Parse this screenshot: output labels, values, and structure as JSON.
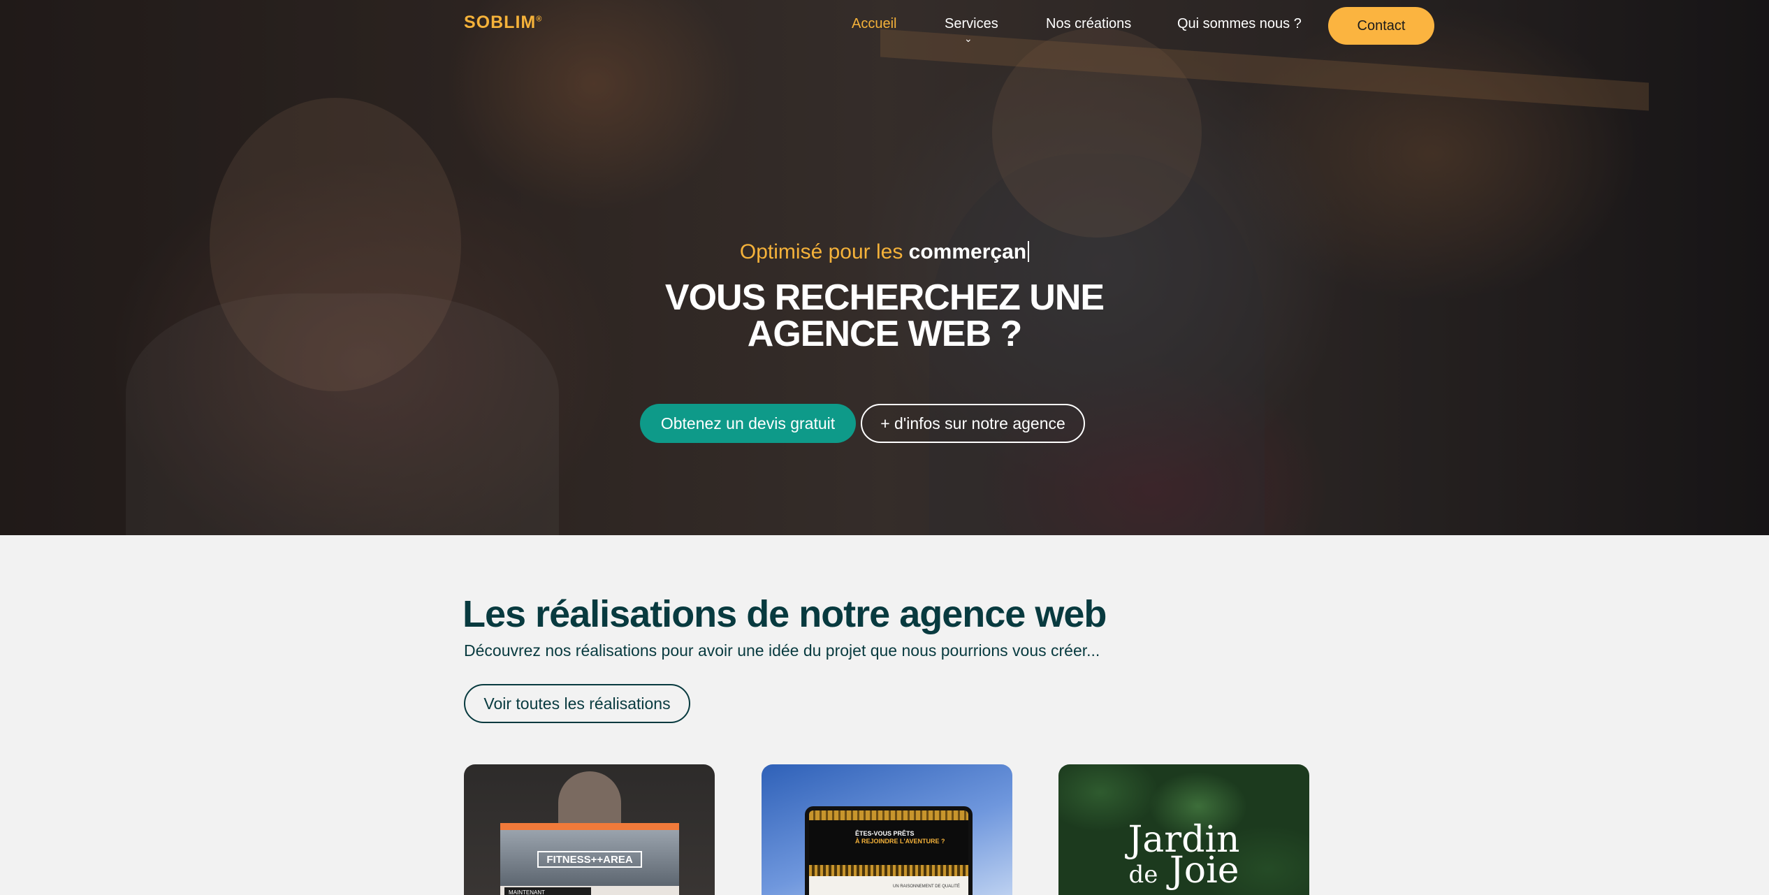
{
  "nav": {
    "logo": "SOBLIM",
    "logo_mark": "®",
    "items": [
      {
        "label": "Accueil",
        "active": true
      },
      {
        "label": "Services",
        "active": false
      },
      {
        "label": "Nos créations",
        "active": false
      },
      {
        "label": "Qui sommes nous ?",
        "active": false
      }
    ],
    "services_chevron": "⌄",
    "contact_label": "Contact"
  },
  "hero": {
    "tagline_prefix": "Optimisé pour les",
    "tagline_typed": "commerçan",
    "headline_line1": "VOUS RECHERCHEZ UNE",
    "headline_line2": "AGENCE WEB ?",
    "cta_primary": "Obtenez un devis gratuit",
    "cta_secondary": "+ d'infos sur notre agence"
  },
  "realisations": {
    "title": "Les réalisations de notre agence web",
    "subtitle": "Découvrez nos réalisations pour avoir une idée du projet que nous pourrions vous créer...",
    "view_all_label": "Voir toutes les réalisations",
    "cards": [
      {
        "name": "fitness",
        "logo_text": "FITNESS++AREA",
        "snippet": "MAINTENANT"
      },
      {
        "name": "aventure",
        "line1": "ÊTES-VOUS PRÊTS",
        "line2": "À REJOINDRE L'AVENTURE ?",
        "snippet": "UN RAISONNEMENT DE QUALITÉ"
      },
      {
        "name": "jardin",
        "line1": "Jardin",
        "line2": "de",
        "line3": "Joie"
      }
    ]
  },
  "colors": {
    "accent_orange": "#f5b23a",
    "contact_button": "#fbb440",
    "teal_button": "#0e9a89",
    "dark_teal_text": "#083a3f",
    "section_bg": "#f2f2f2"
  }
}
